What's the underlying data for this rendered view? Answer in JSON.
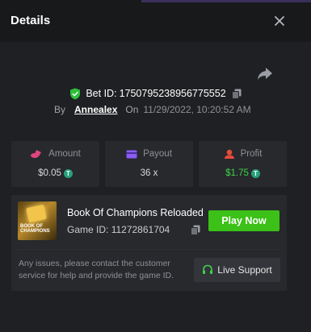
{
  "header": {
    "title": "Details",
    "close_icon": "close-icon"
  },
  "bet": {
    "id_label": "Bet ID:",
    "id_value": "1750795238956775552",
    "by_label": "By",
    "user": "Annealex",
    "on_label": "On",
    "datetime": "11/29/2022, 10:20:52 AM"
  },
  "stats": {
    "amount": {
      "label": "Amount",
      "value": "$0.05",
      "icon": "coins-icon"
    },
    "payout": {
      "label": "Payout",
      "value": "36 x",
      "icon": "card-icon"
    },
    "profit": {
      "label": "Profit",
      "value": "$1.75",
      "icon": "profit-icon"
    }
  },
  "currency_symbol": "T",
  "game": {
    "name": "Book Of Champions Reloaded",
    "id_label": "Game ID:",
    "id_value": "11272861704",
    "thumb_text": "BOOK OF CHAMPIONS",
    "play_label": "Play Now"
  },
  "support": {
    "notice": "Any issues, please contact the customer service for help and provide the game ID.",
    "button_label": "Live Support"
  },
  "colors": {
    "accent_green": "#3bc117",
    "profit_green": "#3fd34a",
    "amount_icon": "#e0457b",
    "payout_icon": "#8b5cf6",
    "profit_icon": "#e84a3a",
    "background": "#1f2023",
    "panel": "#27292d"
  }
}
